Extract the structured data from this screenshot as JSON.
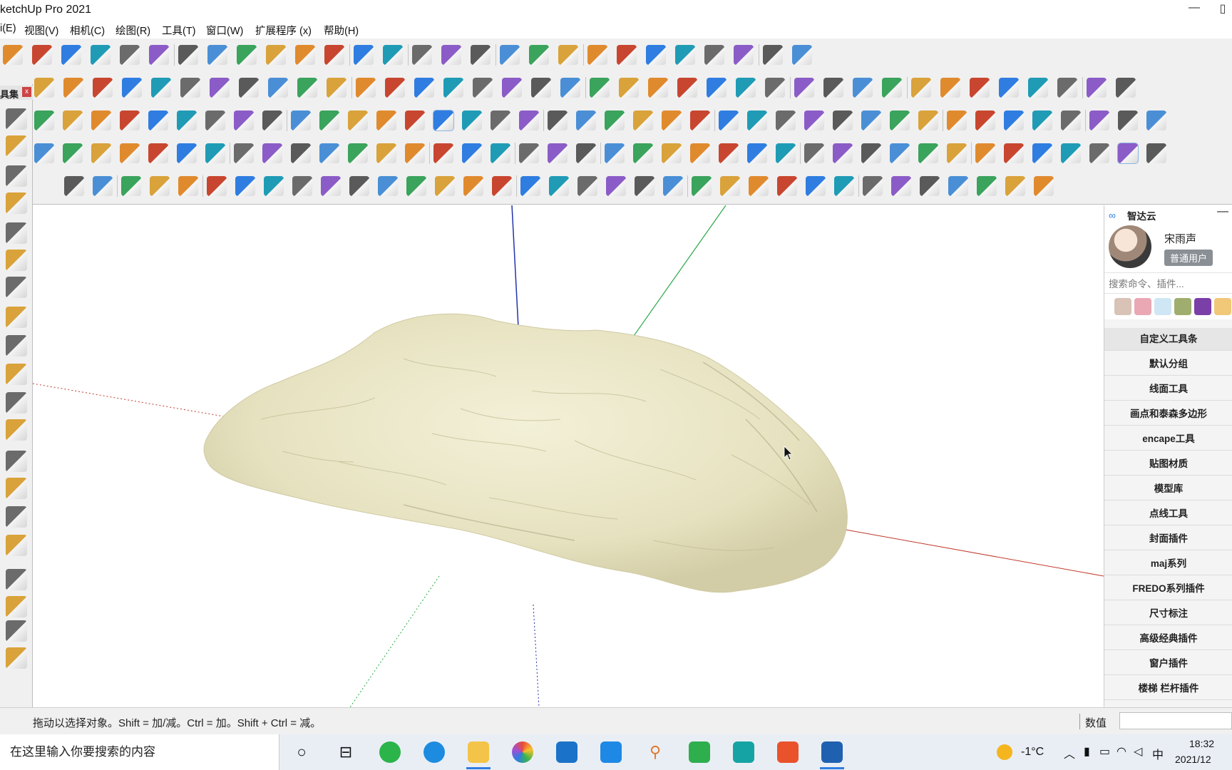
{
  "window": {
    "title": "ketchUp Pro 2021",
    "minimize_glyph": "—",
    "panel_glyph": "▯"
  },
  "menu": [
    "i(E)",
    "视图(V)",
    "相机(C)",
    "绘图(R)",
    "工具(T)",
    "窗口(W)",
    "扩展程序 (x)",
    "帮助(H)"
  ],
  "left_palette": {
    "label": "具集",
    "close_glyph": "x"
  },
  "right_panel": {
    "brand": "智达云",
    "minimize_glyph": "—",
    "user": {
      "name": "宋雨声",
      "role": "普通用户"
    },
    "search_placeholder": "搜索命令、插件...",
    "categories": [
      "自定义工具条",
      "默认分组",
      "线面工具",
      "画点和泰森多边形",
      "encape工具",
      "贴图材质",
      "模型库",
      "点线工具",
      "封面插件",
      "maj系列",
      "FREDO系列插件",
      "尺寸标注",
      "高级经典插件",
      "窗户插件",
      "楼梯 栏杆插件"
    ]
  },
  "statusbar": {
    "hint": "拖动以选择对象。Shift = 加/减。Ctrl = 加。Shift + Ctrl = 减。",
    "value_label": "数值",
    "value": ""
  },
  "taskbar": {
    "search_placeholder": "在这里输入你要搜索的内容",
    "weather_temp": "-1°C",
    "ime": "中",
    "time": "18:32",
    "date": "2021/12"
  },
  "colors": {
    "accent": "#2f7de1",
    "axis_red": "#c0392b",
    "axis_green": "#27a844",
    "axis_blue": "#2233aa",
    "rock_fill": "#ede9c9"
  }
}
